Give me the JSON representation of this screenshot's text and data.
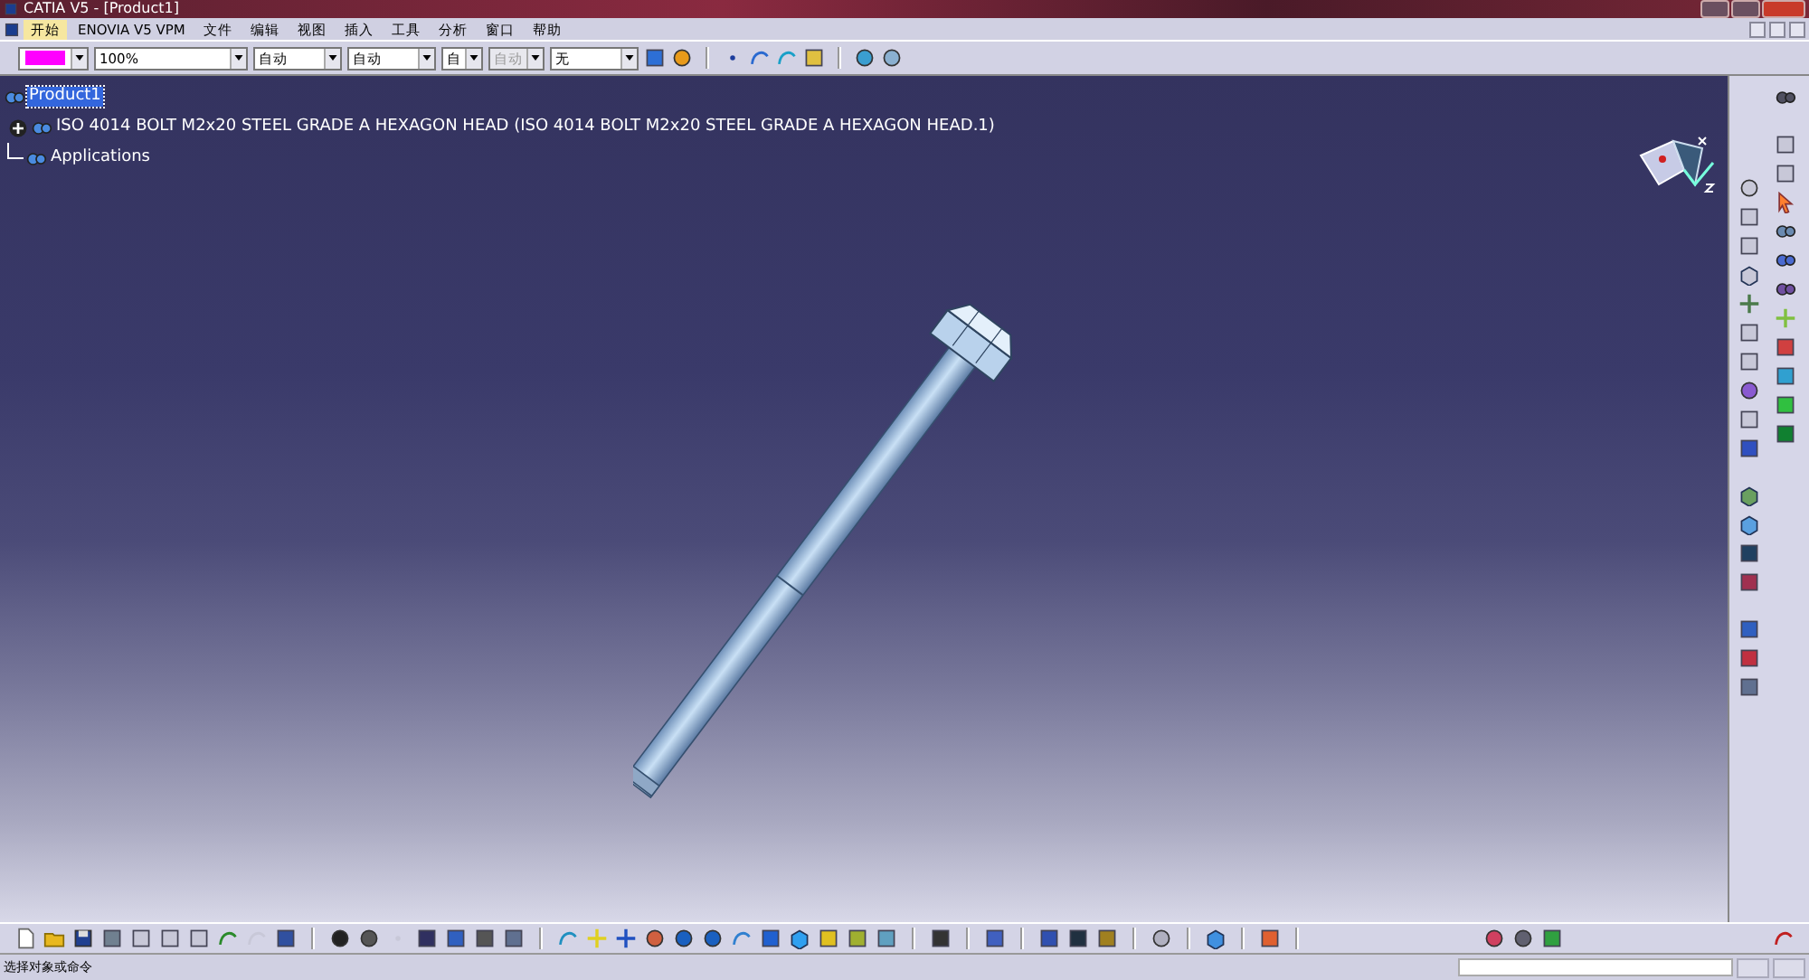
{
  "window": {
    "title": "CATIA V5 - [Product1]"
  },
  "menu_bar": {
    "items": [
      {
        "label": "开始",
        "selected": true
      },
      {
        "label": "ENOVIA V5 VPM",
        "selected": false
      },
      {
        "label": "文件",
        "selected": false
      },
      {
        "label": "编辑",
        "selected": false
      },
      {
        "label": "视图",
        "selected": false
      },
      {
        "label": "插入",
        "selected": false
      },
      {
        "label": "工具",
        "selected": false
      },
      {
        "label": "分析",
        "selected": false
      },
      {
        "label": "窗口",
        "selected": false
      },
      {
        "label": "帮助",
        "selected": false
      }
    ]
  },
  "properties_toolbar": {
    "fields": [
      {
        "kind": "color",
        "color": "#ff00ff",
        "disabled": false
      },
      {
        "kind": "text",
        "value": "100%",
        "disabled": false
      },
      {
        "kind": "text",
        "value": "自动",
        "disabled": false
      },
      {
        "kind": "text",
        "value": "自动",
        "disabled": false
      },
      {
        "kind": "text",
        "value": "自",
        "disabled": false
      },
      {
        "kind": "text",
        "value": "自动",
        "disabled": true
      },
      {
        "kind": "text",
        "value": "无",
        "disabled": false
      }
    ]
  },
  "tree": {
    "items": [
      {
        "label": "Product1",
        "selected": true,
        "expandable": false,
        "children": [
          {
            "label": "ISO 4014 BOLT M2x20 STEEL GRADE A HEXAGON HEAD (ISO 4014 BOLT M2x20 STEEL GRADE A HEXAGON HEAD.1)",
            "selected": false,
            "expandable": true
          },
          {
            "label": "Applications",
            "selected": false,
            "expandable": false
          }
        ]
      }
    ]
  },
  "status_bar": {
    "prompt": "选择对象或命令"
  }
}
